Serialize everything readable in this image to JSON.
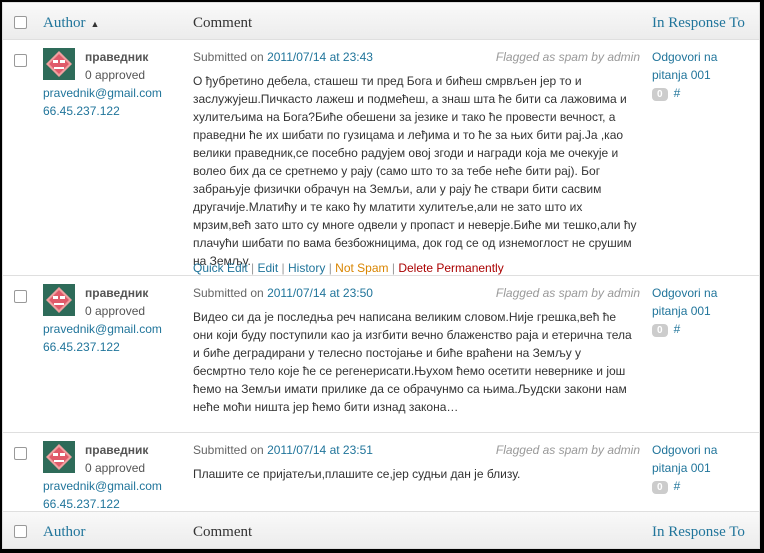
{
  "header": {
    "author": "Author",
    "comment": "Comment",
    "in_response_to": "In Response To"
  },
  "footer": {
    "author": "Author",
    "comment": "Comment",
    "in_response_to": "In Response To"
  },
  "comments": [
    {
      "author": "праведник",
      "approved": "0 approved",
      "email": "pravednik@gmail.com",
      "ip": "66.45.237.122",
      "submitted_prefix": "Submitted on",
      "date": "2011/07/14 at 23:43",
      "flag": "Flagged as spam by admin",
      "text": "О ђубретино дебела, сташеш ти пред Бога и бићеш смрвљен јер то и заслужујеш.Пичкасто лажеш и подмећеш, а знаш шта ће бити са лажовима и хулитељима на Бога?Биће обешени за језике и тако ће провести вечност, а праведни ће их шибати по гузицама и леђима и то ће за њих бити рај.Ја ,као велики праведник,се посебно радујем овој згоди и награди која ме очекује и волео бих да се сретнемо у рају (само што то за тебе неће бити рај). Бог забрањује физички обрачун на Земљи, али у рају ће ствари бити сасвим другачије.Млатићу и те како ћу млатити хулитеље,али не зато што их мрзим,већ зато што су многе одвели у пропаст и неверје.Биће ми тешко,али ћу плачући шибати по вама безбожницима, док год се од изнемоглост не срушим на Земљу.",
      "actions": {
        "quick_edit": "Quick Edit",
        "edit": "Edit",
        "history": "History",
        "not_spam": "Not Spam",
        "delete": "Delete Permanently",
        "sep": "|"
      },
      "response": {
        "title": "Odgovori na pitanja 001",
        "count": "0",
        "hash": "#"
      }
    },
    {
      "author": "праведник",
      "approved": "0 approved",
      "email": "pravednik@gmail.com",
      "ip": "66.45.237.122",
      "submitted_prefix": "Submitted on",
      "date": "2011/07/14 at 23:50",
      "flag": "Flagged as spam by admin",
      "text": "Видео си да је последња реч написана великим словом.Није грешка,већ ће они који буду поступили као ја изгбити вечно блаженство раја и етерична тела и биће деградирани у телесно постојање и биће враћени на Земљу у бесмртно тело које ће се регенерисати.Њухом ћемо осетити невернике и још ћемо на Земљи имати прилике да се обрачунмо са њима.Људски закони нам неће моћи ништа јер ћемо бити изнад закона…",
      "response": {
        "title": "Odgovori na pitanja 001",
        "count": "0",
        "hash": "#"
      }
    },
    {
      "author": "праведник",
      "approved": "0 approved",
      "email": "pravednik@gmail.com",
      "ip": "66.45.237.122",
      "submitted_prefix": "Submitted on",
      "date": "2011/07/14 at 23:51",
      "flag": "Flagged as spam by admin",
      "text": "Плашите се пријатељи,плашите се,јер судњи дан је близу.",
      "response": {
        "title": "Odgovori na pitanja 001",
        "count": "0",
        "hash": "#"
      }
    }
  ]
}
